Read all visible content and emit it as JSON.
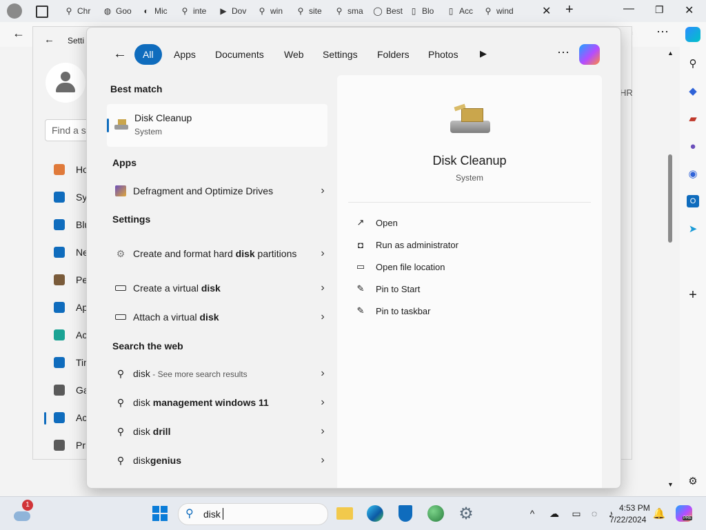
{
  "browser": {
    "tabs": [
      {
        "label": "Chr",
        "icon": "search-icon"
      },
      {
        "label": "Goo",
        "icon": "chrome-icon"
      },
      {
        "label": "Mic",
        "icon": "edge-icon"
      },
      {
        "label": "inte",
        "icon": "search-icon"
      },
      {
        "label": "Dov",
        "icon": "play-icon"
      },
      {
        "label": "win",
        "icon": "search-icon"
      },
      {
        "label": "site",
        "icon": "search-icon"
      },
      {
        "label": "sma",
        "icon": "search-icon"
      },
      {
        "label": "Best",
        "icon": "chat-icon"
      },
      {
        "label": "Blo",
        "icon": "page-icon"
      },
      {
        "label": "Acc",
        "icon": "page-icon"
      },
      {
        "label": "wind",
        "icon": "search-icon"
      }
    ]
  },
  "settings": {
    "title": "Setti",
    "find_placeholder": "Find a se",
    "nav": [
      {
        "label": "Ho",
        "icon": "home-icon"
      },
      {
        "label": "Sys",
        "icon": "system-icon"
      },
      {
        "label": "Blu",
        "icon": "bluetooth-icon"
      },
      {
        "label": "Ne",
        "icon": "wifi-icon"
      },
      {
        "label": "Per",
        "icon": "brush-icon"
      },
      {
        "label": "Ap",
        "icon": "apps-icon"
      },
      {
        "label": "Acc",
        "icon": "person-icon"
      },
      {
        "label": "Tim",
        "icon": "clock-icon"
      },
      {
        "label": "Ga",
        "icon": "gamepad-icon"
      },
      {
        "label": "Acc",
        "icon": "accessibility-icon"
      },
      {
        "label": "Pri",
        "icon": "shield-icon"
      }
    ],
    "right_clip": "HR"
  },
  "flyout": {
    "filters": [
      "All",
      "Apps",
      "Documents",
      "Web",
      "Settings",
      "Folders",
      "Photos"
    ],
    "best_match": {
      "heading": "Best match",
      "title": "Disk Cleanup",
      "subtitle": "System"
    },
    "apps": {
      "heading": "Apps",
      "items": [
        {
          "label": "Defragment and Optimize Drives"
        }
      ]
    },
    "settings_section": {
      "heading": "Settings",
      "items": [
        {
          "prefix": "Create and format hard ",
          "bold": "disk",
          "suffix": " partitions"
        },
        {
          "prefix": "Create a virtual ",
          "bold": "disk",
          "suffix": ""
        },
        {
          "prefix": "Attach a virtual ",
          "bold": "disk",
          "suffix": ""
        }
      ]
    },
    "web": {
      "heading": "Search the web",
      "items": [
        {
          "prefix": "disk",
          "bold": "",
          "sub": " - See more search results"
        },
        {
          "prefix": "disk",
          "bold": " management windows 11",
          "sub": ""
        },
        {
          "prefix": "disk",
          "bold": " drill",
          "sub": ""
        },
        {
          "prefix": "disk",
          "bold": "genius",
          "sub": ""
        }
      ]
    },
    "preview": {
      "title": "Disk Cleanup",
      "subtitle": "System",
      "actions": [
        {
          "label": "Open",
          "icon": "open-external-icon"
        },
        {
          "label": "Run as administrator",
          "icon": "admin-shield-icon"
        },
        {
          "label": "Open file location",
          "icon": "folder-icon"
        },
        {
          "label": "Pin to Start",
          "icon": "pin-icon"
        },
        {
          "label": "Pin to taskbar",
          "icon": "pin-icon"
        }
      ]
    }
  },
  "taskbar": {
    "weather_badge": "1",
    "search_value": "disk",
    "time": "4:53 PM",
    "date": "7/22/2024",
    "copilot_badge": "PRE"
  },
  "colors": {
    "accent": "#0f6cbd"
  }
}
